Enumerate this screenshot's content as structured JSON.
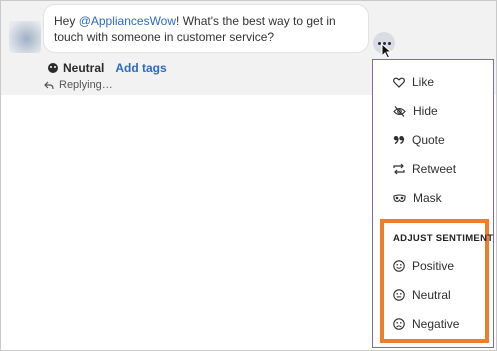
{
  "message": {
    "text_before": "Hey ",
    "mention": "@AppliancesWow",
    "text_after": "! What's the best way to get in touch with someone in customer service?"
  },
  "meta": {
    "sentiment": "Neutral",
    "add_tags": "Add tags",
    "replying": "Replying…"
  },
  "menu": {
    "items": [
      {
        "label": "Like",
        "icon": "heart-icon"
      },
      {
        "label": "Hide",
        "icon": "eye-slash-icon"
      },
      {
        "label": "Quote",
        "icon": "quote-icon"
      },
      {
        "label": "Retweet",
        "icon": "retweet-icon"
      },
      {
        "label": "Mask",
        "icon": "mask-icon"
      }
    ],
    "sentiment_title": "ADJUST SENTIMENT",
    "sentiment_items": [
      {
        "label": "Positive",
        "icon": "smile-icon"
      },
      {
        "label": "Neutral",
        "icon": "neutral-face-icon"
      },
      {
        "label": "Negative",
        "icon": "frown-icon"
      }
    ]
  },
  "colors": {
    "link": "#2a6bc2",
    "highlight": "#ef7d2b",
    "menu_border": "#7c6bb3"
  }
}
